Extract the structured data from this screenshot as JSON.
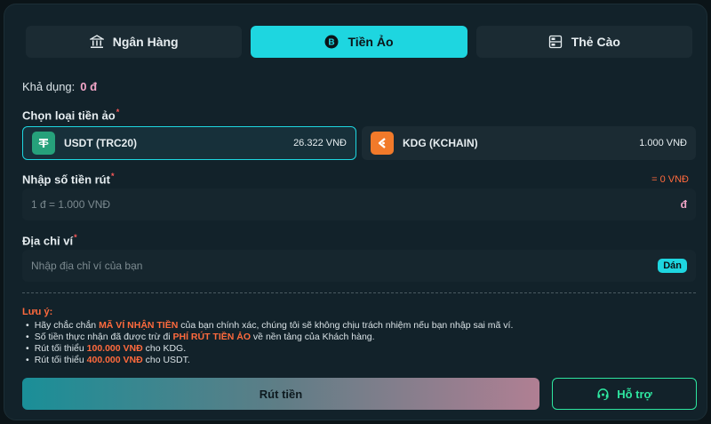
{
  "tabs": [
    {
      "label": "Ngân Hàng",
      "icon": "bank-icon",
      "active": false
    },
    {
      "label": "Tiền Ảo",
      "icon": "bitcoin-icon",
      "active": true
    },
    {
      "label": "Thẻ Cào",
      "icon": "card-icon",
      "active": false
    }
  ],
  "balance": {
    "label": "Khả dụng:",
    "value": "0 đ"
  },
  "coin_section": {
    "label": "Chọn loại tiền ảo",
    "options": [
      {
        "name": "USDT (TRC20)",
        "price": "26.322 VNĐ",
        "icon": "tether-icon",
        "selected": true
      },
      {
        "name": "KDG (KCHAIN)",
        "price": "1.000 VNĐ",
        "icon": "kdg-icon",
        "selected": false
      }
    ]
  },
  "amount": {
    "label": "Nhập số tiền rút",
    "conversion": "= 0 VNĐ",
    "placeholder": "1 đ = 1.000 VNĐ",
    "unit": "đ"
  },
  "wallet": {
    "label": "Địa chỉ ví",
    "placeholder": "Nhập địa chỉ ví của bạn",
    "paste_label": "Dán"
  },
  "notes": {
    "title": "Lưu ý:",
    "items": [
      {
        "pre": "Hãy chắc chắn ",
        "hl": "MÃ VÍ NHẬN TIỀN",
        "post": " của bạn chính xác, chúng tôi sẽ không chịu trách nhiệm nếu bạn nhập sai mã ví."
      },
      {
        "pre": "Số tiền thực nhận đã được trừ đi ",
        "hl": "PHÍ RÚT TIỀN ẢO",
        "post": " về nền tảng của Khách hàng."
      },
      {
        "pre": "Rút tối thiểu ",
        "hl": "100.000 VNĐ",
        "post": " cho KDG."
      },
      {
        "pre": "Rút tối thiểu ",
        "hl": "400.000 VNĐ",
        "post": " cho USDT."
      }
    ]
  },
  "actions": {
    "withdraw_label": "Rút tiền",
    "support_label": "Hỗ trợ"
  },
  "colors": {
    "accent": "#1ed6e0",
    "warning": "#ff6a3d",
    "support": "#2ee6a0"
  }
}
